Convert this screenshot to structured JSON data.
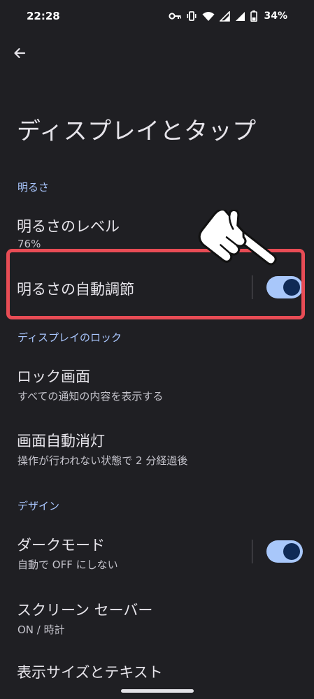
{
  "status_bar": {
    "time": "22:28",
    "battery": "34%",
    "icons": [
      "key-icon",
      "vibrate-icon",
      "wifi-icon",
      "signal-icon",
      "signal-icon",
      "battery-icon"
    ]
  },
  "page": {
    "title": "ディスプレイとタップ"
  },
  "sections": {
    "brightness": {
      "header": "明るさ",
      "level_title": "明るさのレベル",
      "level_value": "76%",
      "auto_title": "明るさの自動調節",
      "auto_enabled": true
    },
    "lock": {
      "header": "ディスプレイのロック",
      "lock_screen_title": "ロック画面",
      "lock_screen_subtitle": "すべての通知の内容を表示する",
      "timeout_title": "画面自動消灯",
      "timeout_subtitle": "操作が行われない状態で 2 分経過後"
    },
    "design": {
      "header": "デザイン",
      "dark_mode_title": "ダークモード",
      "dark_mode_subtitle": "自動で OFF にしない",
      "dark_mode_enabled": true,
      "screensaver_title": "スクリーン セーバー",
      "screensaver_subtitle": "ON / 時計",
      "display_size_title": "表示サイズとテキスト"
    }
  },
  "colors": {
    "background": "#1f1f23",
    "accent": "#aac7ff",
    "toggle_track": "#a8c7fa",
    "toggle_knob": "#0f2a56",
    "highlight": "#e84c55"
  }
}
